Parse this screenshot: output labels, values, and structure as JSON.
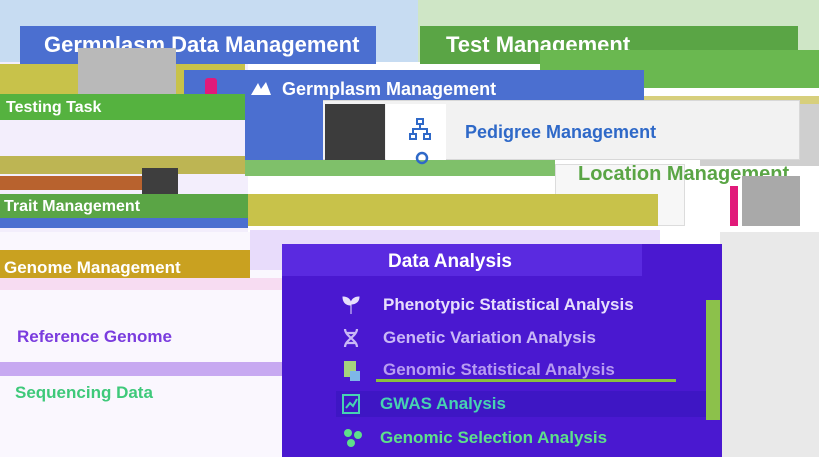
{
  "modules": {
    "germplasm_data_management": "Germplasm Data Management",
    "test_management": "Test Management",
    "germplasm_management": "Germplasm Management",
    "pedigree_management": "Pedigree Management",
    "location_management": "Location Management",
    "testing_task": "Testing Task",
    "phenotype_trait_management": "Trait Management",
    "genome_management": "Genome Management",
    "reference_genome": "Reference Genome",
    "sequencing_data": "Sequencing Data",
    "data_analysis": "Data Analysis",
    "phenotypic_statistical_analysis": "Phenotypic Statistical Analysis",
    "genetic_variation_analysis": "Genetic Variation Analysis",
    "genomic_statistical_analysis": "Genomic Statistical Analysis",
    "gwas_analysis": "GWAS Analysis",
    "genomic_selection_analysis": "Genomic Selection Analysis"
  },
  "icons": {
    "pedigree": "org-chart-icon",
    "phenotypic": "seedling-icon",
    "genetic_variation": "dna-icon",
    "genomic_statistical": "document-chart-icon",
    "gwas": "chart-icon",
    "genomic_selection": "molecule-icon",
    "location": "location-pin-icon"
  },
  "colors": {
    "header_blue": "#4b6fd0",
    "header_green": "#5aa545",
    "panel_purple": "#4a18d0",
    "accent_blue": "#2f69c8",
    "ref_genome_purple": "#7a3cde",
    "sequencing_green": "#3ec97a"
  }
}
